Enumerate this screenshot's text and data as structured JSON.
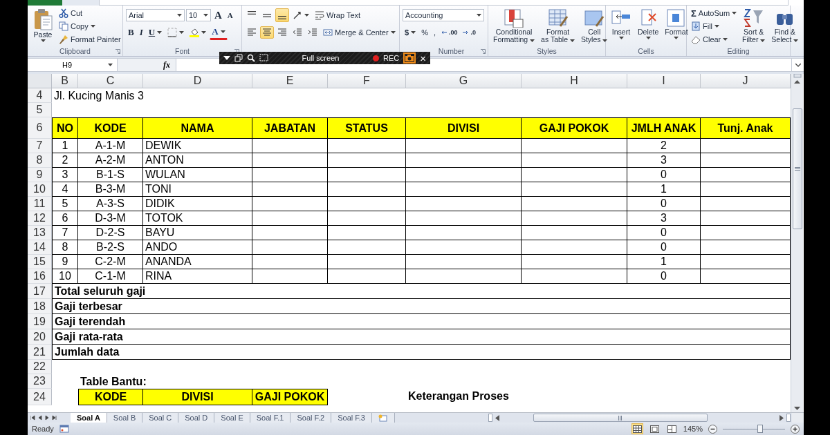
{
  "ribbon": {
    "groups": [
      {
        "kind": "clipboard",
        "label": "Clipboard",
        "paste": "Paste",
        "cut": "Cut",
        "copy": "Copy",
        "format_painter": "Format Painter"
      },
      {
        "kind": "font",
        "label": "Font",
        "font_name": "Arial",
        "font_size": "10",
        "grow": "A",
        "shrink": "A",
        "bold": "B",
        "italic": "I",
        "underline": "U",
        "font_color": "A"
      },
      {
        "kind": "alignment",
        "vertical_align": [
          {
            "kind": "top",
            "selected": false
          },
          {
            "kind": "middle",
            "selected": false
          },
          {
            "kind": "bottom",
            "selected": true
          }
        ],
        "horizontal_align": [
          {
            "kind": "left",
            "selected": false
          },
          {
            "kind": "center",
            "selected": true
          },
          {
            "kind": "right",
            "selected": false
          }
        ],
        "wrap_text": "Wrap Text",
        "merge_center": "Merge & Center"
      },
      {
        "kind": "number",
        "label": "Number",
        "format": "Accounting",
        "currency": "$",
        "percent": "%",
        "comma": ",",
        "increase_decimal": ".00",
        "decrease_decimal": ".0"
      },
      {
        "kind": "styles",
        "label": "Styles",
        "buttons": [
          {
            "kind": "conditional",
            "lines": [
              "Conditional",
              "Formatting"
            ]
          },
          {
            "kind": "table",
            "lines": [
              "Format",
              "as Table"
            ]
          },
          {
            "kind": "cell",
            "lines": [
              "Cell",
              "Styles"
            ]
          }
        ]
      },
      {
        "kind": "cells",
        "label": "Cells",
        "buttons": [
          {
            "kind": "insert",
            "label": "Insert"
          },
          {
            "kind": "delete",
            "label": "Delete"
          },
          {
            "kind": "format",
            "label": "Format"
          }
        ]
      },
      {
        "kind": "editing",
        "label": "Editing",
        "autosum_symbol": "Σ",
        "autosum": "AutoSum",
        "fill": "Fill",
        "clear": "Clear",
        "buttons": [
          {
            "kind": "sort",
            "lines": [
              "Sort &",
              "Filter"
            ]
          },
          {
            "kind": "find",
            "lines": [
              "Find &",
              "Select"
            ]
          }
        ]
      }
    ]
  },
  "recorder_bar": {
    "label": "Full screen",
    "rec": "REC",
    "close": "×"
  },
  "formula_bar": {
    "name_box": "H9",
    "function_label": "fx"
  },
  "sheet": {
    "columns": [
      "B",
      "C",
      "D",
      "E",
      "F",
      "G",
      "H",
      "I",
      "J"
    ],
    "rows": [
      {
        "number": "4",
        "kind": "text",
        "text": "Jl. Kucing Manis 3"
      },
      {
        "number": "5",
        "kind": "blank"
      },
      {
        "number": "6",
        "kind": "header",
        "cells": [
          "NO",
          "KODE",
          "NAMA",
          "JABATAN",
          "STATUS",
          "DIVISI",
          "GAJI POKOK",
          "JMLH ANAK",
          "Tunj. Anak"
        ]
      },
      {
        "number": "7",
        "kind": "data",
        "no": "1",
        "kode": "A-1-M",
        "nama": "DEWIK",
        "jmlh_anak": "2"
      },
      {
        "number": "8",
        "kind": "data",
        "no": "2",
        "kode": "A-2-M",
        "nama": "ANTON",
        "jmlh_anak": "3"
      },
      {
        "number": "9",
        "kind": "data",
        "no": "3",
        "kode": "B-1-S",
        "nama": "WULAN",
        "jmlh_anak": "0"
      },
      {
        "number": "10",
        "kind": "data",
        "no": "4",
        "kode": "B-3-M",
        "nama": "TONI",
        "jmlh_anak": "1"
      },
      {
        "number": "11",
        "kind": "data",
        "no": "5",
        "kode": "A-3-S",
        "nama": "DIDIK",
        "jmlh_anak": "0"
      },
      {
        "number": "12",
        "kind": "data",
        "no": "6",
        "kode": "D-3-M",
        "nama": "TOTOK",
        "jmlh_anak": "3"
      },
      {
        "number": "13",
        "kind": "data",
        "no": "7",
        "kode": "D-2-S",
        "nama": "BAYU",
        "jmlh_anak": "0"
      },
      {
        "number": "14",
        "kind": "data",
        "no": "8",
        "kode": "B-2-S",
        "nama": "ANDO",
        "jmlh_anak": "0"
      },
      {
        "number": "15",
        "kind": "data",
        "no": "9",
        "kode": "C-2-M",
        "nama": "ANANDA",
        "jmlh_anak": "1"
      },
      {
        "number": "16",
        "kind": "data",
        "no": "10",
        "kode": "C-1-M",
        "nama": "RINA",
        "jmlh_anak": "0"
      },
      {
        "number": "17",
        "kind": "summary",
        "label": "Total seluruh gaji"
      },
      {
        "number": "18",
        "kind": "summary",
        "label": "Gaji terbesar"
      },
      {
        "number": "19",
        "kind": "summary",
        "label": "Gaji terendah"
      },
      {
        "number": "20",
        "kind": "summary",
        "label": "Gaji rata-rata"
      },
      {
        "number": "21",
        "kind": "summary",
        "label": "Jumlah data"
      },
      {
        "number": "22",
        "kind": "blank"
      },
      {
        "number": "23",
        "kind": "caption",
        "text": "Table Bantu:"
      },
      {
        "number": "24",
        "kind": "subheader",
        "cells": [
          "KODE",
          "DIVISI",
          "GAJI POKOK"
        ],
        "note": "Keterangan Proses"
      }
    ]
  },
  "sheet_tabs": [
    {
      "label": "Soal A",
      "selected": true
    },
    {
      "label": "Soal B",
      "selected": false
    },
    {
      "label": "Soal C",
      "selected": false
    },
    {
      "label": "Soal D",
      "selected": false
    },
    {
      "label": "Soal E",
      "selected": false
    },
    {
      "label": "Soal F.1",
      "selected": false
    },
    {
      "label": "Soal F.2",
      "selected": false
    },
    {
      "label": "Soal F.3",
      "selected": false
    }
  ],
  "status_bar": {
    "ready": "Ready",
    "views": [
      {
        "kind": "normal",
        "selected": true
      },
      {
        "kind": "layout",
        "selected": false
      },
      {
        "kind": "page_break",
        "selected": false
      }
    ],
    "zoom": "145%",
    "zoom_slider": {
      "level": 0.6
    }
  }
}
